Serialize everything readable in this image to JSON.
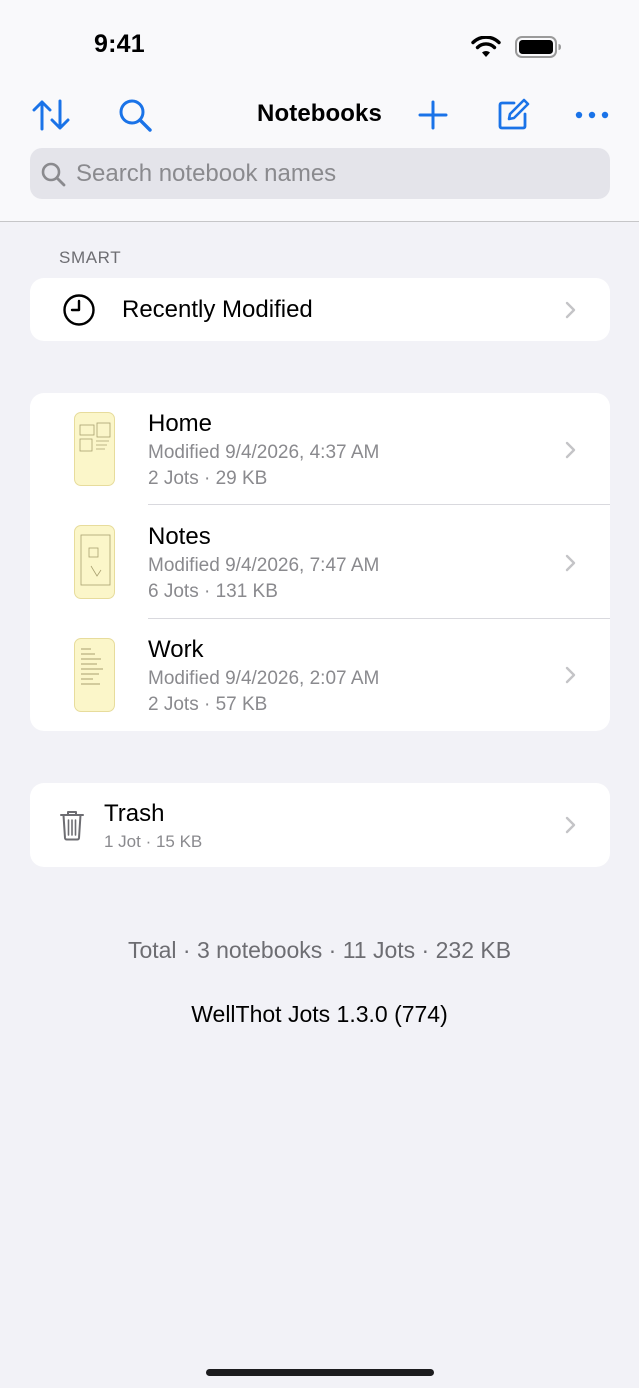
{
  "status_bar": {
    "time": "9:41"
  },
  "nav": {
    "title": "Notebooks",
    "sort_icon": "sort-arrows-icon",
    "search_icon": "search-icon",
    "add_icon": "plus-icon",
    "compose_icon": "compose-icon",
    "more_icon": "ellipsis-icon",
    "accent_color": "#1a73e8"
  },
  "search": {
    "placeholder": "Search notebook names"
  },
  "smart": {
    "header": "SMART",
    "recent": {
      "label": "Recently Modified",
      "icon": "clock-icon"
    }
  },
  "notebooks": [
    {
      "name": "Home",
      "modified": "Modified 9/4/2026, 4:37 AM",
      "details": "2 Jots · 29 KB"
    },
    {
      "name": "Notes",
      "modified": "Modified 9/4/2026, 7:47 AM",
      "details": "6 Jots · 131 KB"
    },
    {
      "name": "Work",
      "modified": "Modified 9/4/2026, 2:07 AM",
      "details": "2 Jots · 57 KB"
    }
  ],
  "trash": {
    "name": "Trash",
    "details": "1 Jot · 15 KB",
    "icon": "trash-icon"
  },
  "footer": {
    "total": "Total · 3 notebooks · 11 Jots · 232 KB",
    "version": "WellThot Jots 1.3.0 (774)"
  }
}
